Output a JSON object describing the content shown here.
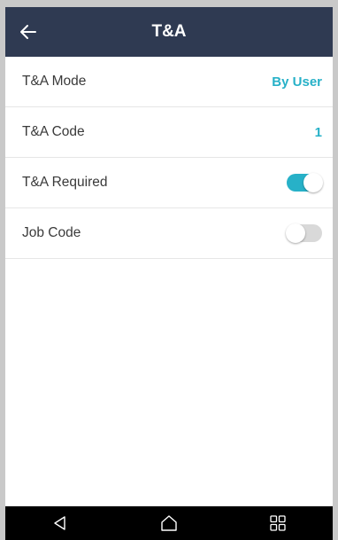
{
  "app_bar": {
    "title": "T&A",
    "back_icon": "arrow-left-icon",
    "background_color": "#2f3a52"
  },
  "settings": [
    {
      "label": "T&A Mode",
      "value": "By User",
      "type": "value"
    },
    {
      "label": "T&A Code",
      "value": "1",
      "type": "value"
    },
    {
      "label": "T&A Required",
      "state": "on",
      "type": "toggle"
    },
    {
      "label": "Job Code",
      "state": "off",
      "type": "toggle"
    }
  ],
  "accent_color": "#27b1c8",
  "nav_bar": {
    "back_icon": "triangle-back-icon",
    "home_icon": "home-icon",
    "recents_icon": "recents-grid-icon"
  }
}
